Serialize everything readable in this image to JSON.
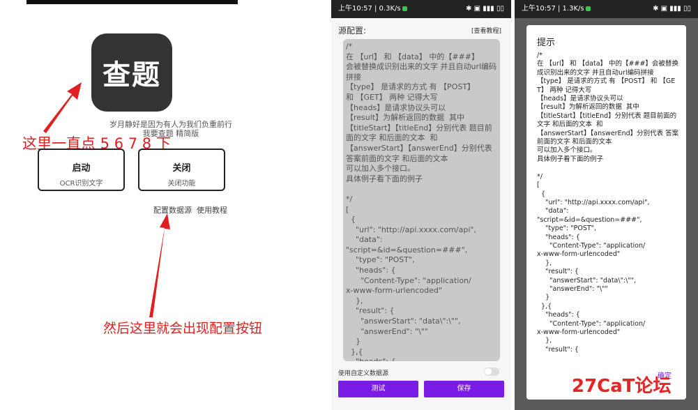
{
  "panel1": {
    "logo_text": "查题",
    "slogan": "岁月静好是因为有人为我们负重前行",
    "version": "我要查题 精简版",
    "note_tap": "这里一直点 5 6 7 8 下",
    "start_button": {
      "title": "启动",
      "subtitle": "OCR识别文字"
    },
    "close_button": {
      "title": "关闭",
      "subtitle": "关闭功能"
    },
    "config_link": "配置数据源",
    "tutorial_link": "使用教程",
    "note_appear": "然后这里就会出现配置按钮",
    "accent_color": "#e02020"
  },
  "panel2": {
    "status_time": "上午10:57 | 0.3K/s",
    "status_right": "✱ ▣ ▮▮▮ ▯▯",
    "title": "源配置:",
    "view_link": "[查看教程]",
    "source_text": "/*\n在 【url】 和 【data】 中的【###】\n会被替换成识别出来的文字 并且自动url编码拼接\n【type】 是请求的方式 有 【POST】\n和 【GET】 两种 记得大写\n【heads】是请求协议头可以\n【result】为解析返回的数据  其中\n【titleStart】【titleEnd】分别代表 题目前面的文字 和后面的文本  和\n【answerStart】【answerEnd】分别代表 答案前面的文字 和后面的文本\n可以加入多个接口。\n具体例子看下面的例子\n\n*/\n[\n  {\n    \"url\": \"http://api.xxxx.com/api\",\n    \"data\":\n\"script=&id=&question=###\",\n    \"type\": \"POST\",\n    \"heads\": {\n      \"Content-Type\": \"application/\nx-www-form-urlencoded\"\n    },\n    \"result\": {\n      \"answerStart\": \"data\\\":\\\"\",\n      \"answerEnd\": \"\\\"\"\n    }\n  },{\n    \"heads\": {",
    "toggle_label": "使用自定义数据源",
    "test_button": "测试",
    "save_button": "保存",
    "button_color": "#7a1be6"
  },
  "panel3": {
    "status_time": "上午10:57 | 1.3K/s",
    "status_right": "✱ ▣ ▮▮▮ ▯▯",
    "dialog_title": "提示",
    "dialog_text": "/*\n在 【url】 和 【data】 中的【###】会被替换成识别出来的文字 并且自动url编码拼接\n【type】 是请求的方式 有 【POST】 和 【GET】 两种 记得大写\n【heads】是请求协议头可以\n【result】为解析返回的数据  其中\n【titleStart】【titleEnd】分别代表 题目前面的文字 和后面的文本  和\n【answerStart】【answerEnd】分别代表 答案前面的文字 和后面的文本\n可以加入多个接口。\n具体例子看下面的例子\n\n*/\n[\n  {\n    \"url\": \"http://api.xxxx.com/api\",\n    \"data\":\n\"script=&id=&question=###\",\n    \"type\": \"POST\",\n    \"heads\": {\n      \"Content-Type\": \"application/\nx-www-form-urlencoded\"\n    },\n    \"result\": {\n      \"answerStart\": \"data\\\":\\\"\",\n      \"answerEnd\": \"\\\"\"\n    }\n  },{\n    \"heads\": {\n      \"Content-Type\": \"application/\nx-www-form-urlencoded\"\n    },\n    \"result\": {",
    "ok_button": "确定",
    "watermark": "27CaT论坛"
  }
}
